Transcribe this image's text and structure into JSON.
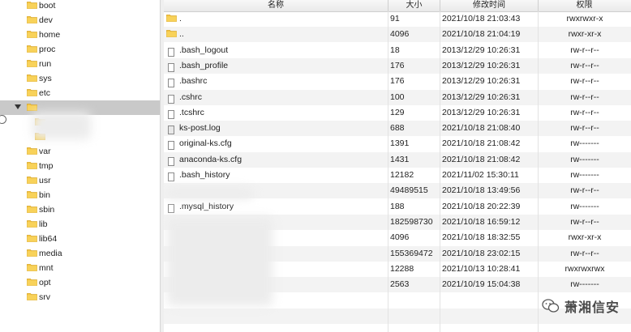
{
  "tree": {
    "items": [
      {
        "label": "boot"
      },
      {
        "label": "dev"
      },
      {
        "label": "home"
      },
      {
        "label": "proc"
      },
      {
        "label": "run"
      },
      {
        "label": "sys"
      },
      {
        "label": "etc"
      },
      {
        "label": ""
      },
      {
        "label": ""
      },
      {
        "label": ""
      },
      {
        "label": "var"
      },
      {
        "label": "tmp"
      },
      {
        "label": "usr"
      },
      {
        "label": "bin"
      },
      {
        "label": "sbin"
      },
      {
        "label": "lib"
      },
      {
        "label": "lib64"
      },
      {
        "label": "media"
      },
      {
        "label": "mnt"
      },
      {
        "label": "opt"
      },
      {
        "label": "srv"
      }
    ]
  },
  "list": {
    "columns": {
      "name": "名称",
      "size": "大小",
      "modified": "修改时间",
      "perm": "权限"
    },
    "rows": [
      {
        "icon": "folder-icon",
        "name": ".",
        "size": "91",
        "modified": "2021/10/18 21:03:43",
        "perm": "rwxrwxr-x"
      },
      {
        "icon": "folder-icon",
        "name": "..",
        "size": "4096",
        "modified": "2021/10/18 21:04:19",
        "perm": "rwxr-xr-x"
      },
      {
        "icon": "file-icon",
        "name": ".bash_logout",
        "size": "18",
        "modified": "2013/12/29 10:26:31",
        "perm": "rw-r--r--"
      },
      {
        "icon": "file-icon",
        "name": ".bash_profile",
        "size": "176",
        "modified": "2013/12/29 10:26:31",
        "perm": "rw-r--r--"
      },
      {
        "icon": "file-icon",
        "name": ".bashrc",
        "size": "176",
        "modified": "2013/12/29 10:26:31",
        "perm": "rw-r--r--"
      },
      {
        "icon": "file-icon",
        "name": ".cshrc",
        "size": "100",
        "modified": "2013/12/29 10:26:31",
        "perm": "rw-r--r--"
      },
      {
        "icon": "file-icon",
        "name": ".tcshrc",
        "size": "129",
        "modified": "2013/12/29 10:26:31",
        "perm": "rw-r--r--"
      },
      {
        "icon": "log-file-icon",
        "name": "ks-post.log",
        "size": "688",
        "modified": "2021/10/18 21:08:40",
        "perm": "rw-r--r--"
      },
      {
        "icon": "file-icon",
        "name": "original-ks.cfg",
        "size": "1391",
        "modified": "2021/10/18 21:08:42",
        "perm": "rw-------"
      },
      {
        "icon": "file-icon",
        "name": "anaconda-ks.cfg",
        "size": "1431",
        "modified": "2021/10/18 21:08:42",
        "perm": "rw-------"
      },
      {
        "icon": "file-icon",
        "name": ".bash_history",
        "size": "12182",
        "modified": "2021/11/02 15:30:11",
        "perm": "rw-------"
      },
      {
        "icon": "",
        "name": "",
        "size": "49489515",
        "modified": "2021/10/18 13:49:56",
        "perm": "rw-r--r--"
      },
      {
        "icon": "file-icon",
        "name": ".mysql_history",
        "size": "188",
        "modified": "2021/10/18 20:22:39",
        "perm": "rw-------"
      },
      {
        "icon": "",
        "name": "",
        "size": "182598730",
        "modified": "2021/10/18 16:59:12",
        "perm": "rw-r--r--"
      },
      {
        "icon": "",
        "name": "",
        "size": "4096",
        "modified": "2021/10/18 18:32:55",
        "perm": "rwxr-xr-x"
      },
      {
        "icon": "",
        "name": "",
        "size": "155369472",
        "modified": "2021/10/18 23:02:15",
        "perm": "rw-r--r--"
      },
      {
        "icon": "",
        "name": "",
        "size": "12288",
        "modified": "2021/10/13 10:28:41",
        "perm": "rwxrwxrwx"
      },
      {
        "icon": "",
        "name": "",
        "size": "2563",
        "modified": "2021/10/19 15:04:38",
        "perm": "rw-------"
      }
    ]
  },
  "watermark": {
    "text": "萧湘信安"
  },
  "colors": {
    "folder": "#f5c542",
    "selected": "#c9c9c9",
    "altrow": "#f3f3f3"
  }
}
